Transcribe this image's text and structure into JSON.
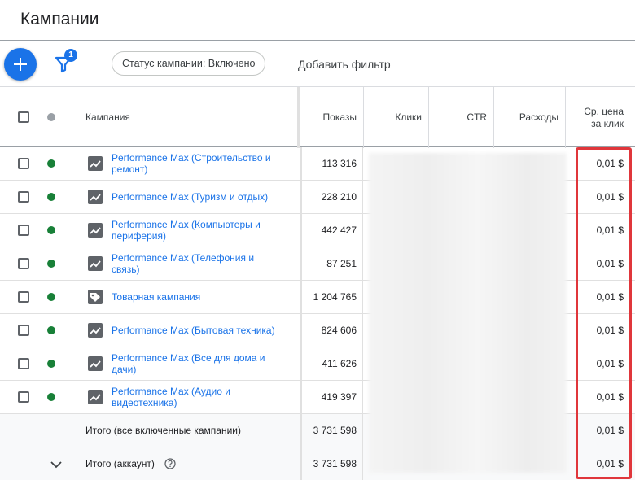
{
  "page": {
    "title": "Кампании"
  },
  "toolbar": {
    "filter_badge": "1",
    "status_chip": "Статус кампании: Включено",
    "add_filter": "Добавить фильтр"
  },
  "columns": {
    "campaign": "Кампания",
    "impressions": "Показы",
    "clicks": "Клики",
    "ctr": "CTR",
    "cost": "Расходы",
    "avg_cpc_line1": "Ср. цена",
    "avg_cpc_line2": "за клик"
  },
  "rows": [
    {
      "name": "Performance Max (Строительство и ремонт)",
      "icon": "performance-max-icon",
      "status": "enabled",
      "impressions": "113 316",
      "avg_cpc": "0,01 $"
    },
    {
      "name": "Performance Max (Туризм и отдых)",
      "icon": "performance-max-icon",
      "status": "enabled",
      "impressions": "228 210",
      "avg_cpc": "0,01 $"
    },
    {
      "name": "Performance Max (Компьютеры и периферия)",
      "icon": "performance-max-icon",
      "status": "enabled",
      "impressions": "442 427",
      "avg_cpc": "0,01 $"
    },
    {
      "name": "Performance Max (Телефония и связь)",
      "icon": "performance-max-icon",
      "status": "enabled",
      "impressions": "87 251",
      "avg_cpc": "0,01 $"
    },
    {
      "name": "Товарная кампания",
      "icon": "shopping-tag-icon",
      "status": "enabled",
      "impressions": "1 204 765",
      "avg_cpc": "0,01 $"
    },
    {
      "name": "Performance Max (Бытовая техника)",
      "icon": "performance-max-icon",
      "status": "enabled",
      "impressions": "824 606",
      "avg_cpc": "0,01 $"
    },
    {
      "name": "Performance Max (Все для дома и дачи)",
      "icon": "performance-max-icon",
      "status": "enabled",
      "impressions": "411 626",
      "avg_cpc": "0,01 $"
    },
    {
      "name": "Performance Max (Аудио и видеотехника)",
      "icon": "performance-max-icon",
      "status": "enabled",
      "impressions": "419 397",
      "avg_cpc": "0,01 $"
    }
  ],
  "totals": [
    {
      "label": "Итого (все включенные кампании)",
      "impressions": "3 731 598",
      "avg_cpc": "0,01 $"
    },
    {
      "label": "Итого (аккаунт)",
      "impressions": "3 731 598",
      "avg_cpc": "0,01 $"
    }
  ],
  "colors": {
    "accent": "#1a73e8",
    "enabled_dot": "#188038",
    "highlight": "#e0363b"
  }
}
